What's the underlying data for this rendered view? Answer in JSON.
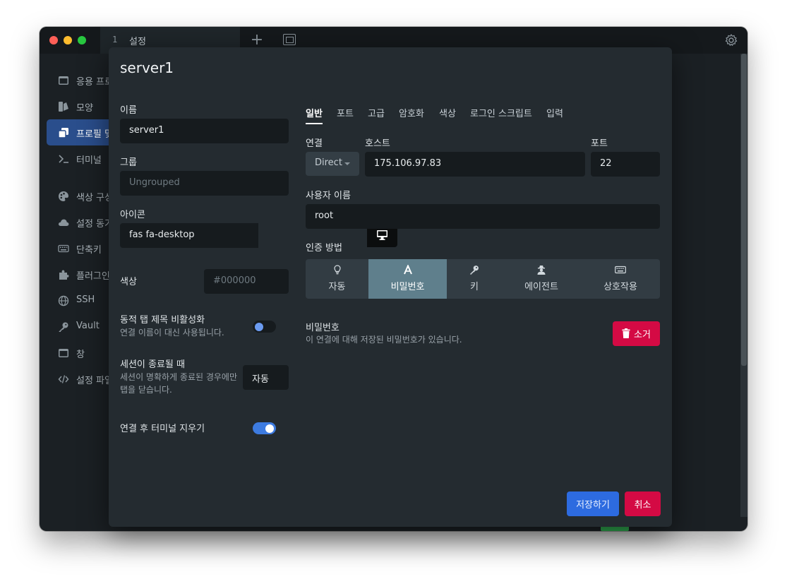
{
  "window": {
    "tab_number": "1",
    "tab_title": "설정"
  },
  "sidebar": {
    "items": [
      {
        "label": "응용 프로",
        "icon": "window-icon"
      },
      {
        "label": "모양",
        "icon": "paint-brush-icon"
      },
      {
        "label": "프로필 및",
        "icon": "layers-icon"
      },
      {
        "label": "터미널",
        "icon": "terminal-icon"
      },
      {
        "label": "색상 구성",
        "icon": "palette-icon"
      },
      {
        "label": "설정 동기",
        "icon": "cloud-icon"
      },
      {
        "label": "단축키",
        "icon": "keyboard-icon"
      },
      {
        "label": "플러그인",
        "icon": "puzzle-icon"
      },
      {
        "label": "SSH",
        "icon": "globe-icon"
      },
      {
        "label": "Vault",
        "icon": "key-icon"
      },
      {
        "label": "창",
        "icon": "window-icon"
      },
      {
        "label": "설정 파일",
        "icon": "code-icon"
      }
    ]
  },
  "modal": {
    "title": "server1",
    "left": {
      "name_label": "이름",
      "name_value": "server1",
      "group_label": "그룹",
      "group_placeholder": "Ungrouped",
      "icon_label": "아이콘",
      "icon_value": "fas fa-desktop",
      "color_label": "색상",
      "color_placeholder": "#000000",
      "dynamic_title_label": "동적 탭 제목 비활성화",
      "dynamic_title_desc": "연결 이름이 대신 사용됩니다.",
      "dynamic_title_enabled": false,
      "session_end_label": "세션이 종료될 때",
      "session_end_desc": "세션이 명확하게 종료된 경우에만 탭을 닫습니다.",
      "session_end_value": "자동",
      "clear_terminal_label": "연결 후 터미널 지우기",
      "clear_terminal_enabled": true
    },
    "tabs": [
      "일반",
      "포트",
      "고급",
      "암호화",
      "색상",
      "로그인 스크립트",
      "입력"
    ],
    "active_tab": "일반",
    "general": {
      "connection_label": "연결",
      "connection_value": "Direct",
      "host_label": "호스트",
      "host_value": "175.106.97.83",
      "port_label": "포트",
      "port_value": "22",
      "username_label": "사용자 이름",
      "username_value": "root",
      "auth_label": "인증 방법",
      "auth_options": [
        {
          "label": "자동",
          "icon": "lightbulb-icon"
        },
        {
          "label": "비밀번호",
          "icon": "font-icon"
        },
        {
          "label": "키",
          "icon": "key-icon"
        },
        {
          "label": "에이전트",
          "icon": "user-secret-icon"
        },
        {
          "label": "상호작용",
          "icon": "keyboard-icon"
        }
      ],
      "auth_selected": "비밀번호",
      "password_label": "비밀번호",
      "password_desc": "이 연결에 대해 저장된 비밀번호가 있습니다.",
      "delete_label": "소거"
    },
    "save_label": "저장하기",
    "cancel_label": "취소"
  },
  "colors": {
    "accent_blue": "#2d6be0",
    "danger_red": "#d40a44",
    "active_auth": "#5f7f8c"
  }
}
